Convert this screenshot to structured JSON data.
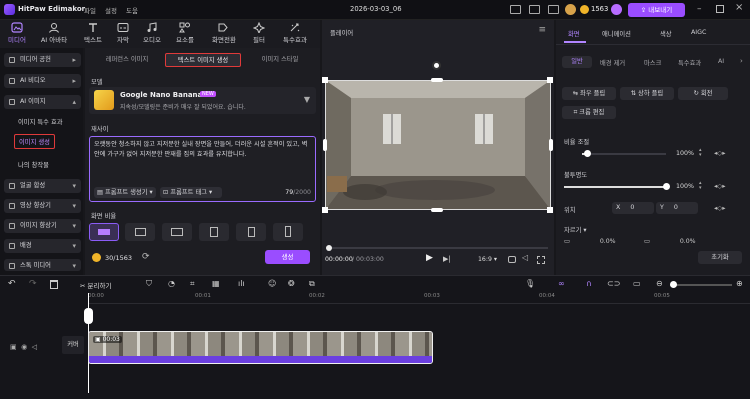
{
  "app": {
    "name": "HitPaw Edimakor",
    "menu": [
      "파일",
      "설정",
      "도움"
    ],
    "project_title": "2026-03-03_06",
    "credits": "1563",
    "export_label": "내보내기"
  },
  "toolbar": {
    "items": [
      {
        "label": "미디어",
        "icon": "media-icon",
        "active": true
      },
      {
        "label": "AI 아바타",
        "icon": "ai-avatar-icon"
      },
      {
        "label": "텍스트",
        "icon": "text-icon"
      },
      {
        "label": "자막",
        "icon": "subtitle-icon"
      },
      {
        "label": "오디오",
        "icon": "audio-icon"
      },
      {
        "label": "요소를",
        "icon": "elements-icon"
      },
      {
        "label": "화면전환",
        "icon": "transition-icon"
      },
      {
        "label": "필터",
        "icon": "filter-icon"
      },
      {
        "label": "특수효과",
        "icon": "effects-icon"
      }
    ]
  },
  "sidebar": {
    "items": [
      {
        "label": "미디어 공헌",
        "caret": "▸"
      },
      {
        "label": "AI 비디오",
        "caret": "▸"
      },
      {
        "label": "AI 이미지",
        "caret": "▴"
      }
    ],
    "subitems": [
      "이미지 특수 효과",
      "이미지 생성",
      "나의 창작물"
    ],
    "items_below": [
      {
        "label": "얼굴 합성",
        "caret": "▾"
      },
      {
        "label": "영상 향상기",
        "caret": "▾"
      },
      {
        "label": "이미지 향상기",
        "caret": "▾"
      },
      {
        "label": "배경",
        "caret": "▾"
      },
      {
        "label": "스톡 미디어",
        "caret": "▾"
      }
    ]
  },
  "panel": {
    "tabs": [
      "레퍼런스 이미지",
      "텍스트 이미지 생성",
      "이미지 스타일"
    ],
    "model_label": "모델",
    "model_name": "Google Nano Banana",
    "model_badge": "NEW",
    "model_desc": "지속성/모델링은 준비가 매우 잘 되었어요. 습니다.",
    "desc_label": "재사이",
    "prompt_text": "오랫동안 청소하지 않고 지저분한 실내 장면을 만들어, 더러운 시설 흔적이 있고, 벽 안에 가구가 없어 지저분한 판재를 집의 효과를 유지합니다.",
    "prompt_generator": "프롬프트 생성기",
    "prompt_tags": "프롬프트 태그",
    "char_count": "79",
    "char_max": "/2000",
    "ratio_label": "화면 비율",
    "credits_text": "30/1563",
    "generate_label": "생성"
  },
  "preview": {
    "title": "플레이어",
    "time_current": "00:00:00",
    "time_total": "/ 00:03:00",
    "aspect": "16:9"
  },
  "props": {
    "tabs": [
      "화면",
      "애니메이션",
      "색상",
      "AIGC"
    ],
    "subtabs": [
      "일반",
      "배경 제거",
      "마스크",
      "특수효과",
      "AI"
    ],
    "buttons": [
      "좌우 플립",
      "상하 플립",
      "회전",
      "크롭 편집"
    ],
    "opacity_label": "비율 조절",
    "opacity_value": "100%",
    "opacity_level": 0.06,
    "blend_label": "불투명도",
    "blend_value": "100%",
    "blend_level": 1.0,
    "position_label": "위치",
    "x_label": "X",
    "x_value": "0",
    "y_label": "Y",
    "y_value": "0",
    "crop_label": "자르기",
    "crop_left_value": "0.0%",
    "crop_top_value": "0.0%",
    "reset_label": "초기화"
  },
  "timeline": {
    "split_label": "분리하기",
    "ruler": [
      "00:00",
      "00:01",
      "00:02",
      "00:03",
      "00:04",
      "00:05"
    ],
    "track_label": "커버",
    "clip_duration": "00:03"
  }
}
